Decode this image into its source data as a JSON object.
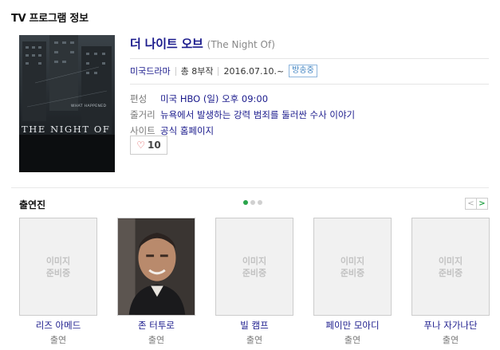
{
  "section": {
    "title": "TV 프로그램 정보"
  },
  "program": {
    "title": "더 나이트 오브",
    "original_title": "(The Night Of)",
    "genre": "미국드라마",
    "episodes": "총 8부작",
    "air_date": "2016.07.10.~",
    "status_badge": "방송중",
    "poster_text": {
      "top": "WHAT HAPPENED",
      "main": "THE NIGHT OF"
    },
    "details": [
      {
        "label": "편성",
        "value": "미국 HBO (일) 오후 09:00"
      },
      {
        "label": "줄거리",
        "value": "뉴욕에서 발생하는 강력 범죄를 둘러싼 수사 이야기"
      },
      {
        "label": "사이트",
        "value": "공식 홈페이지"
      }
    ],
    "likes": "10"
  },
  "cast": {
    "title": "출연진",
    "placeholder": "이미지\n준비중",
    "members": [
      {
        "name": "리즈 아메드",
        "role": "출연",
        "has_photo": false
      },
      {
        "name": "존 터투로",
        "role": "출연",
        "has_photo": true
      },
      {
        "name": "빌 캠프",
        "role": "출연",
        "has_photo": false
      },
      {
        "name": "페이만 모아디",
        "role": "출연",
        "has_photo": false
      },
      {
        "name": "푸나 자가나단",
        "role": "출연",
        "has_photo": false
      }
    ],
    "pager": {
      "prev": "<",
      "next": ">"
    }
  },
  "colors": {
    "link": "#1a1a8c",
    "accent": "#2aa54b",
    "badge": "#3a7fc0"
  },
  "icons": {
    "like": "heart-icon",
    "prev": "chevron-left-icon",
    "next": "chevron-right-icon"
  }
}
